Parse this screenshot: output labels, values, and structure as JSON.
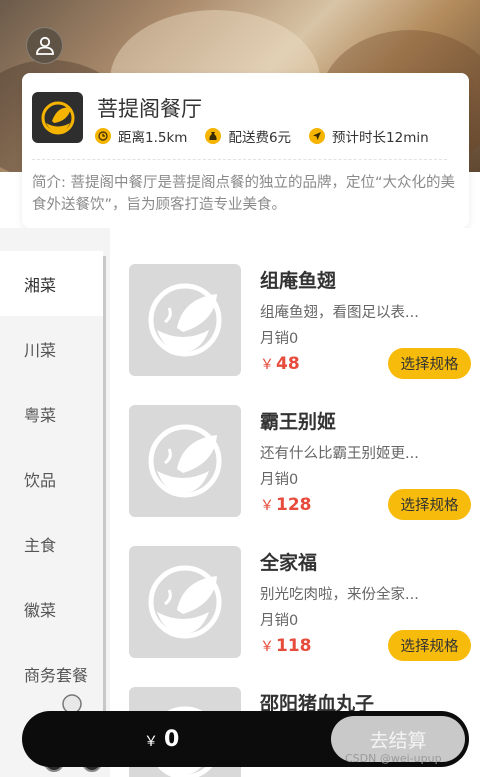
{
  "header": {
    "avatar_icon": "user-icon"
  },
  "shop": {
    "logo_icon": "bowl-leaf-icon",
    "name": "菩提阁餐厅",
    "distance": "距离1.5km",
    "delivery_fee": "配送费6元",
    "eta": "预计时长12min",
    "intro": "简介: 菩提阁中餐厅是菩提阁点餐的独立的品牌，定位“大众化的美食外送餐饮”，旨为顾客打造专业美食。"
  },
  "categories": [
    {
      "label": "湘菜",
      "active": true
    },
    {
      "label": "川菜",
      "active": false
    },
    {
      "label": "粤菜",
      "active": false
    },
    {
      "label": "饮品",
      "active": false
    },
    {
      "label": "主食",
      "active": false
    },
    {
      "label": "徽菜",
      "active": false
    },
    {
      "label": "商务套餐",
      "active": false
    }
  ],
  "dishes": [
    {
      "name": "组庵鱼翅",
      "desc": "组庵鱼翅，看图足以表...",
      "sales": "月销0",
      "price": "48",
      "button": "选择规格"
    },
    {
      "name": "霸王别姬",
      "desc": "还有什么比霸王别姬更...",
      "sales": "月销0",
      "price": "128",
      "button": "选择规格"
    },
    {
      "name": "全家福",
      "desc": "别光吃肉啦，来份全家...",
      "sales": "月销0",
      "price": "118",
      "button": "选择规格"
    },
    {
      "name": "邵阳猪血丸子",
      "desc": "",
      "sales": "",
      "price": "",
      "button": ""
    }
  ],
  "currency": "￥",
  "cart": {
    "total": "0",
    "checkout_label": "去结算"
  },
  "watermark": "CSDN @wei-upup",
  "colors": {
    "accent": "#f7bb0c",
    "price": "#e64b3c",
    "cart_bg": "#0c0c0c"
  }
}
